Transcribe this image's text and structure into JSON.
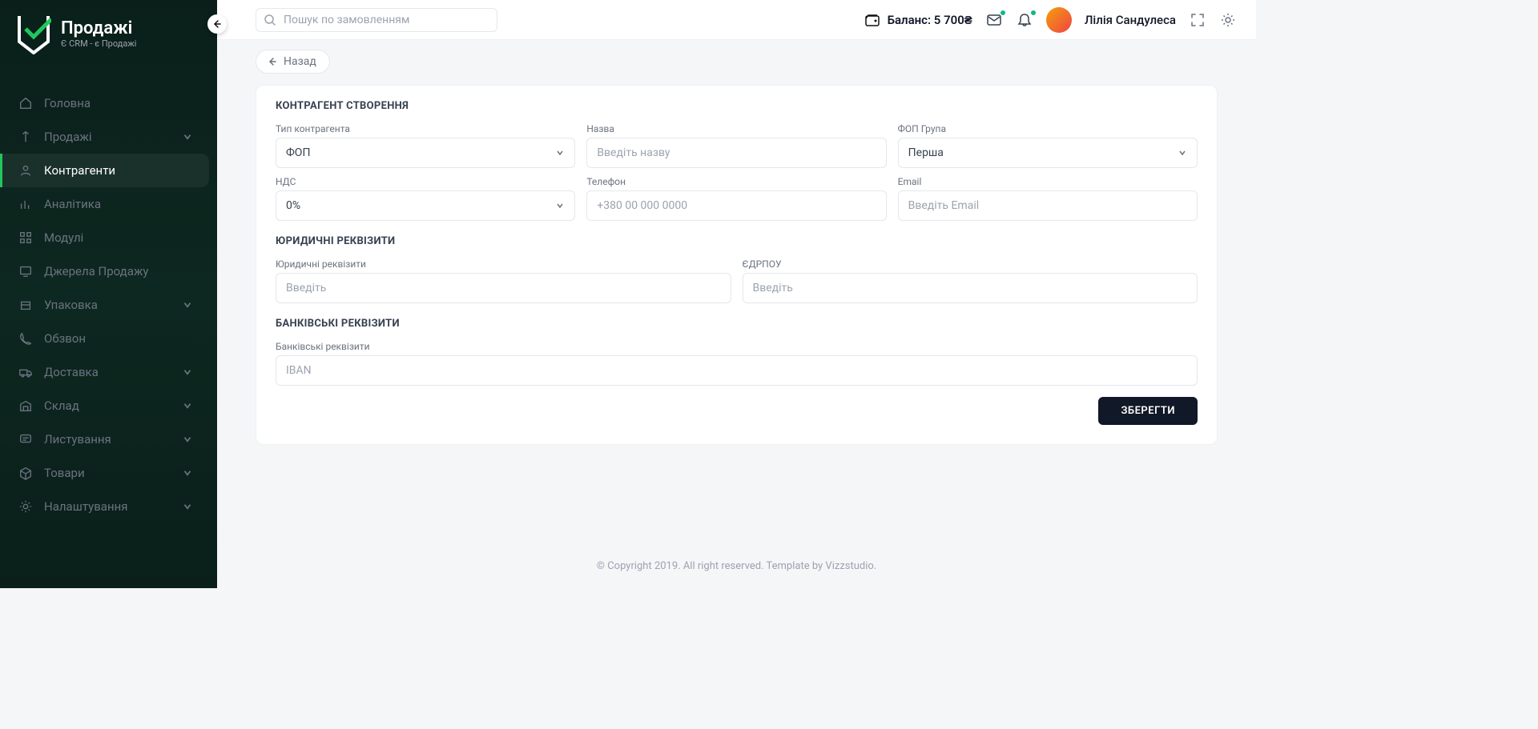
{
  "brand": {
    "title": "Продажі",
    "sub": "Є CRM - є Продажі"
  },
  "sidebar": {
    "items": [
      {
        "label": "Головна",
        "icon": "home",
        "expandable": false
      },
      {
        "label": "Продажі",
        "icon": "sales",
        "expandable": true
      },
      {
        "label": "Контрагенти",
        "icon": "user",
        "expandable": false,
        "active": true
      },
      {
        "label": "Аналітика",
        "icon": "chart",
        "expandable": false
      },
      {
        "label": "Модулі",
        "icon": "grid",
        "expandable": false
      },
      {
        "label": "Джерела Продажу",
        "icon": "tv",
        "expandable": false
      },
      {
        "label": "Упаковка",
        "icon": "box",
        "expandable": true
      },
      {
        "label": "Обзвон",
        "icon": "phone",
        "expandable": false
      },
      {
        "label": "Доставка",
        "icon": "truck",
        "expandable": true
      },
      {
        "label": "Склад",
        "icon": "warehouse",
        "expandable": true
      },
      {
        "label": "Листування",
        "icon": "chat",
        "expandable": true
      },
      {
        "label": "Товари",
        "icon": "package",
        "expandable": true
      },
      {
        "label": "Налаштування",
        "icon": "gear",
        "expandable": true
      }
    ]
  },
  "topbar": {
    "search_placeholder": "Пошук по замовленням",
    "balance_label": "Баланс: 5 700₴",
    "username": "Лілія Сандулеса"
  },
  "page": {
    "back_label": "Назад",
    "title": "КОНТРАГЕНТ СТВОРЕННЯ",
    "fields": {
      "type": {
        "label": "Тип контрагента",
        "value": "ФОП"
      },
      "name": {
        "label": "Назва",
        "placeholder": "Введіть назву"
      },
      "group": {
        "label": "ФОП Група",
        "value": "Перша"
      },
      "vat": {
        "label": "НДС",
        "value": "0%"
      },
      "phone": {
        "label": "Телефон",
        "placeholder": "+380 00 000 0000"
      },
      "email": {
        "label": "Email",
        "placeholder": "Введіть Email"
      }
    },
    "legal": {
      "title": "ЮРИДИЧНІ РЕКВІЗИТИ",
      "details": {
        "label": "Юридичні реквізити",
        "placeholder": "Введіть"
      },
      "edrpou": {
        "label": "ЄДРПОУ",
        "placeholder": "Введіть"
      }
    },
    "bank": {
      "title": "БАНКІВСЬКІ РЕКВІЗИТИ",
      "details": {
        "label": "Банківські реквізити",
        "placeholder": "IBAN"
      }
    },
    "save_label": "ЗБЕРЕГТИ"
  },
  "footer": "© Copyright 2019. All right reserved. Template by Vizzstudio."
}
